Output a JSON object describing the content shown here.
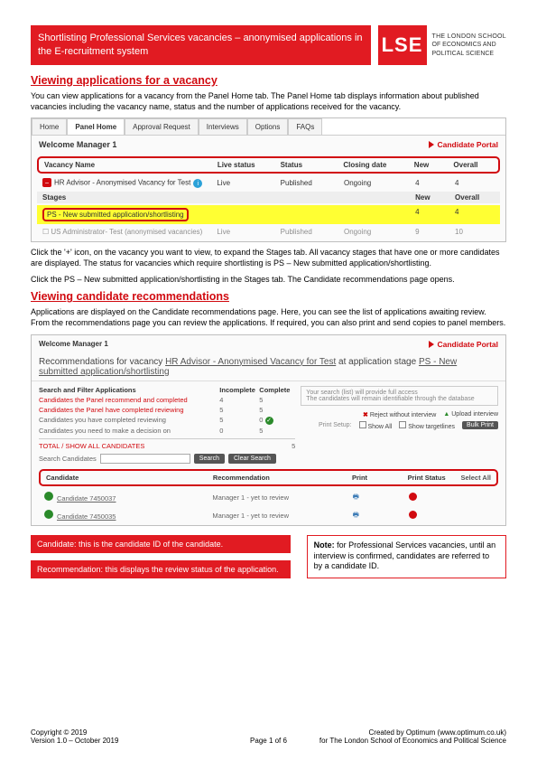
{
  "header": {
    "title": "Shortlisting Professional Services vacancies – anonymised applications in the E-recruitment system",
    "school_line1": "THE LONDON SCHOOL",
    "school_line2": "OF ECONOMICS AND",
    "school_line3": "POLITICAL SCIENCE",
    "logo": "LSE"
  },
  "section1": {
    "heading": "Viewing applications for a vacancy",
    "para1": "You can view applications for a vacancy from the Panel Home tab. The Panel Home tab displays information about published vacancies including the vacancy name, status and the number of applications received for the vacancy."
  },
  "ss1": {
    "tabs": [
      "Home",
      "Panel Home",
      "Approval Request",
      "Interviews",
      "Options",
      "FAQs"
    ],
    "welcome": "Welcome Manager 1",
    "portal": "Candidate Portal",
    "cols": [
      "Vacancy Name",
      "Live status",
      "Status",
      "Closing date",
      "New",
      "Overall"
    ],
    "row1": {
      "name": "HR Advisor - Anonymised Vacancy for Test",
      "live": "Live",
      "status": "Published",
      "closing": "Ongoing",
      "new": "4",
      "overall": "4"
    },
    "stages": {
      "label": "Stages",
      "new": "New",
      "overall": "Overall"
    },
    "hl": {
      "text": "PS - New submitted application/shortlisting",
      "new": "4",
      "overall": "4"
    },
    "row2": {
      "name": "US Administrator- Test (anonymised vacancies)",
      "live": "Live",
      "status": "Published",
      "closing": "Ongoing",
      "new": "9",
      "overall": "10"
    }
  },
  "mid": {
    "para2": "Click the '+' icon, on the vacancy you want to view, to expand the Stages tab. All vacancy stages that have one or more candidates are displayed. The status for vacancies which require shortlisting is PS – New submitted application/shortlisting.",
    "para3": "Click the PS – New submitted application/shortlisting in the Stages tab. The Candidate recommendations page opens."
  },
  "section2": {
    "heading": "Viewing candidate recommendations",
    "para": "Applications are displayed on the Candidate recommendations page. Here, you can see the list of applications awaiting review. From the recommendations page you can review the applications.  If required, you can also print and send copies to panel members."
  },
  "ss2": {
    "welcome": "Welcome Manager 1",
    "portal": "Candidate Portal",
    "title_a": "Recommendations for vacancy ",
    "title_u1": "HR Advisor - Anonymised Vacancy for Test",
    "title_b": " at application stage ",
    "title_u2": "PS - New submitted application/shortlisting",
    "left_h": "Search and Filter Applications",
    "l1": "Candidates the Panel recommend and completed",
    "l2": "Candidates the Panel have completed reviewing",
    "l3": "Candidates you have completed reviewing",
    "l4": "Candidates you need to make a decision on",
    "col_inc": "Incomplete",
    "col_cmp": "Complete",
    "v": [
      "4",
      "5",
      "5",
      "5",
      "5",
      "0",
      "0",
      "5"
    ],
    "tot": "TOTAL / SHOW ALL CANDIDATES",
    "tot_n": "5",
    "search_lbl": "Search Candidates",
    "btn_s": "Search",
    "btn_c": "Clear Search",
    "rb1": "Your search (list) will provide full access",
    "rb2": "The candidates will remain identifiable through the database",
    "opt1": "Reject without interview",
    "opt2": "Upload interview",
    "opt3": "Show targetlines",
    "bulk": "Bulk Print",
    "cand_cols": [
      "Candidate",
      "Recommendation",
      "Print",
      "Print Status",
      ""
    ],
    "c1": {
      "id": "Candidate 7450037",
      "rec": "Manager 1 - yet to review"
    },
    "c2": {
      "id": "Candidate 7450035",
      "rec": "Manager 1 - yet to review"
    },
    "select_all": "Select All"
  },
  "callouts": {
    "c1": "Candidate: this is the candidate ID of the candidate.",
    "c2": "Recommendation: this displays the review status of the application.",
    "note_h": "Note:",
    "note": " for Professional Services vacancies, until an interview is confirmed, candidates are referred to by a candidate ID."
  },
  "footer": {
    "left1": "Copyright © 2019",
    "left2": "Version 1.0 – October 2019",
    "center": "Page 1 of 6",
    "right1": "Created by Optimum (www.optimum.co.uk)",
    "right2": "for The London School of Economics and Political Science"
  }
}
